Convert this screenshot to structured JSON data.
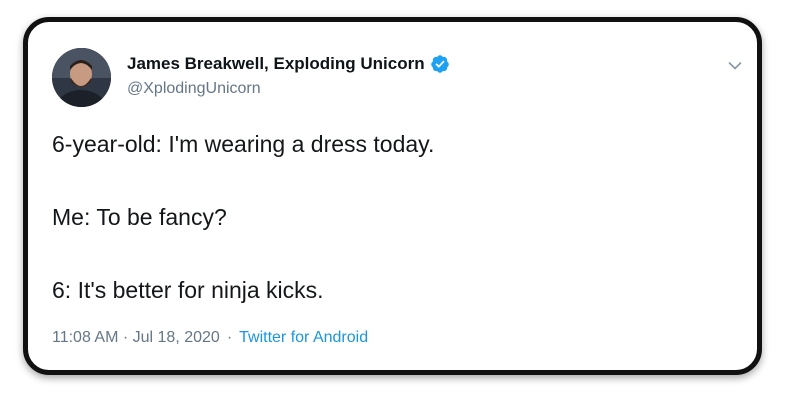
{
  "tweet": {
    "display_name": "James Breakwell, Exploding Unicorn",
    "handle": "@XplodingUnicorn",
    "verified": true,
    "avatar_icon": "profile-photo",
    "menu_icon": "chevron-down-icon",
    "lines": [
      "6-year-old: I'm wearing a dress today.",
      "Me: To be fancy?",
      "6: It's better for ninja kicks."
    ],
    "timestamp": "11:08 AM · Jul 18, 2020",
    "separator": "·",
    "source": "Twitter for Android"
  },
  "colors": {
    "verified_blue": "#1da1f2",
    "link_blue": "#1b95e0",
    "muted_gray": "#657786",
    "text_dark": "#14171a",
    "border": "#111111"
  }
}
